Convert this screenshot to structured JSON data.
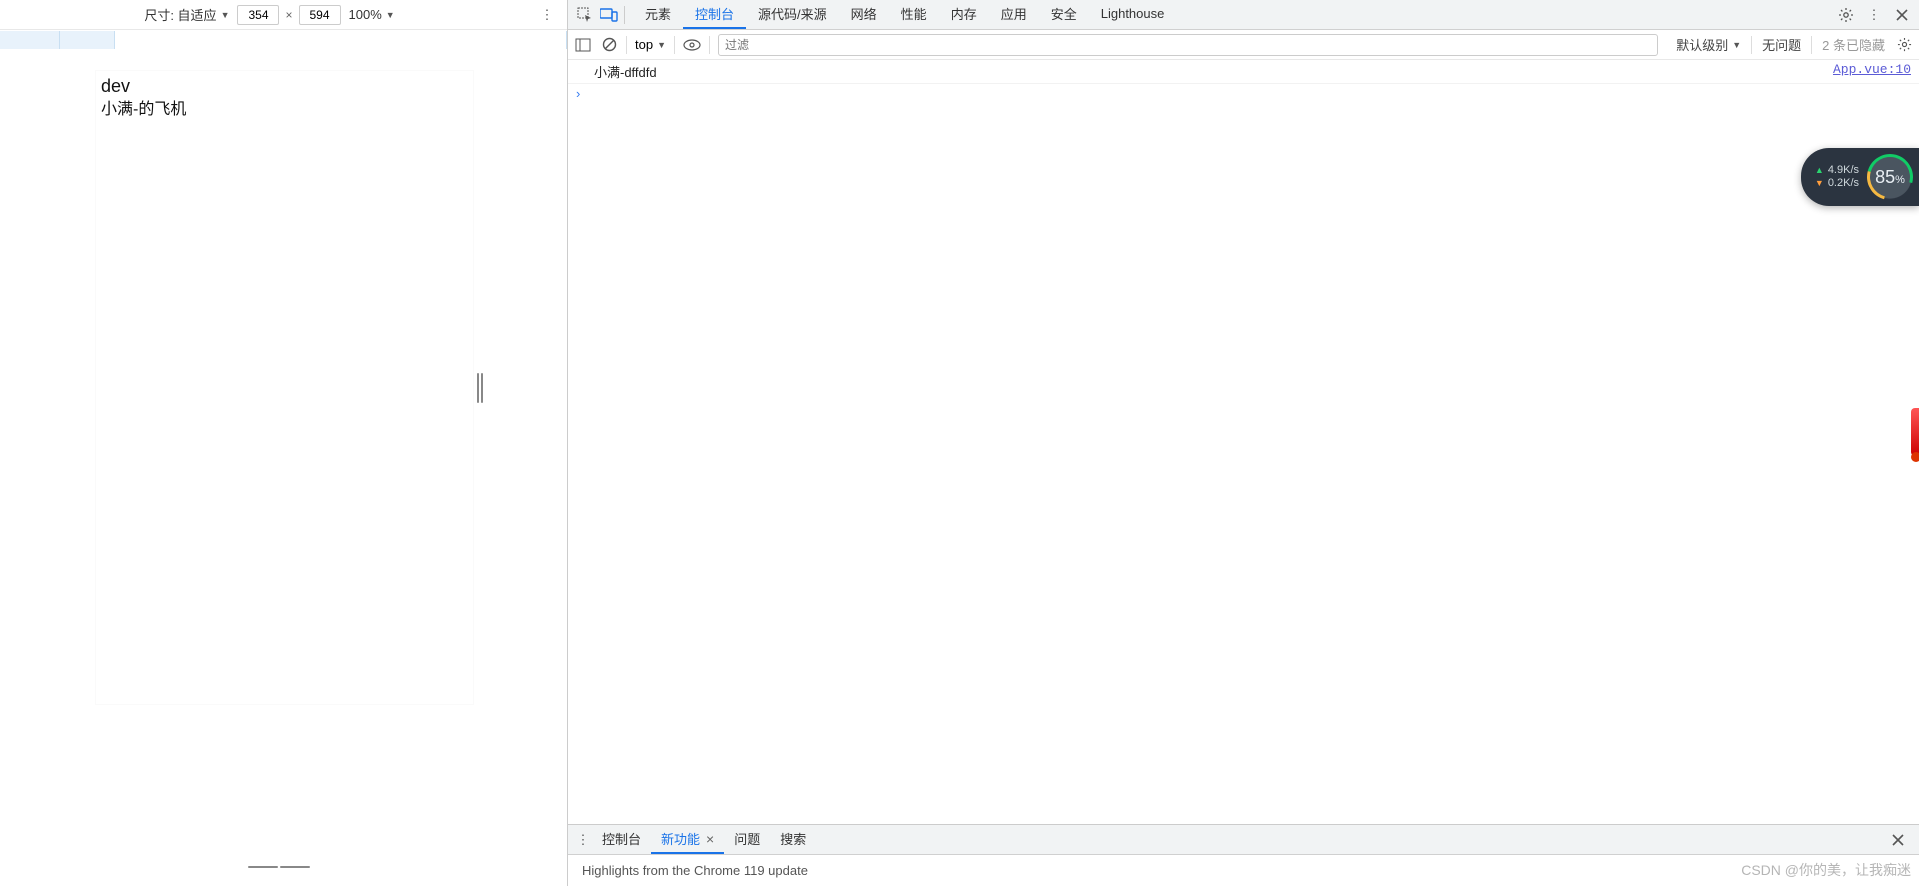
{
  "device_toolbar": {
    "size_label": "尺寸: 自适应",
    "width": "354",
    "height": "594",
    "separator": "×",
    "zoom": "100%"
  },
  "preview": {
    "line1": "dev",
    "line2": "小满-的飞机"
  },
  "devtools": {
    "tabs": [
      "元素",
      "控制台",
      "源代码/来源",
      "网络",
      "性能",
      "内存",
      "应用",
      "安全",
      "Lighthouse"
    ],
    "active_tab_index": 1
  },
  "console_toolbar": {
    "context": "top",
    "filter_placeholder": "过滤",
    "log_level": "默认级别",
    "issues": "无问题",
    "hidden": "2 条已隐藏"
  },
  "console_log": {
    "message": "小满-dffdfd",
    "source": "App.vue:10"
  },
  "drawer": {
    "tabs": [
      "控制台",
      "新功能",
      "问题",
      "搜索"
    ],
    "active_index": 1,
    "body_text": "Highlights from the Chrome 119 update"
  },
  "net_widget": {
    "up": "4.9K/s",
    "down": "0.2K/s",
    "percent": "85",
    "percent_suffix": "%"
  },
  "watermark": "CSDN @你的美，让我痴迷"
}
